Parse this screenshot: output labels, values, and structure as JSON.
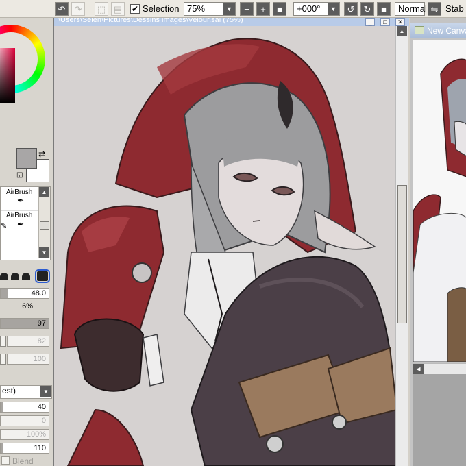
{
  "toolbar": {
    "undo_icon": "undo-icon",
    "redo_icon": "redo-icon",
    "selection_label": "Selection",
    "selection_checked": true,
    "zoom_value": "75%",
    "rotation_value": "+000°",
    "blend_mode": "Normal",
    "stabilizer_label": "Stab"
  },
  "brush_panel": {
    "tools": [
      {
        "label": "AirBrush"
      },
      {
        "label": "AirBrush"
      }
    ],
    "size_value": "48.0",
    "min_size_value": "6%",
    "density_value": "97",
    "texture_value": "82",
    "texture_value_2": "100",
    "mode_label": "est)",
    "blending_value": "40",
    "dilution_value": "0",
    "persistence_value": "100%",
    "last_value": "110",
    "blend_checkbox_label": "Blend"
  },
  "main_window": {
    "title": "\\Users\\Selen\\Pictures\\Dessins images\\Velour.sai (75%)"
  },
  "right_window": {
    "title": "New Canvas"
  },
  "colors": {
    "current_color": "#a8a6a6",
    "secondary_color": "#ffffff",
    "hood_red": "#8e2a30"
  }
}
